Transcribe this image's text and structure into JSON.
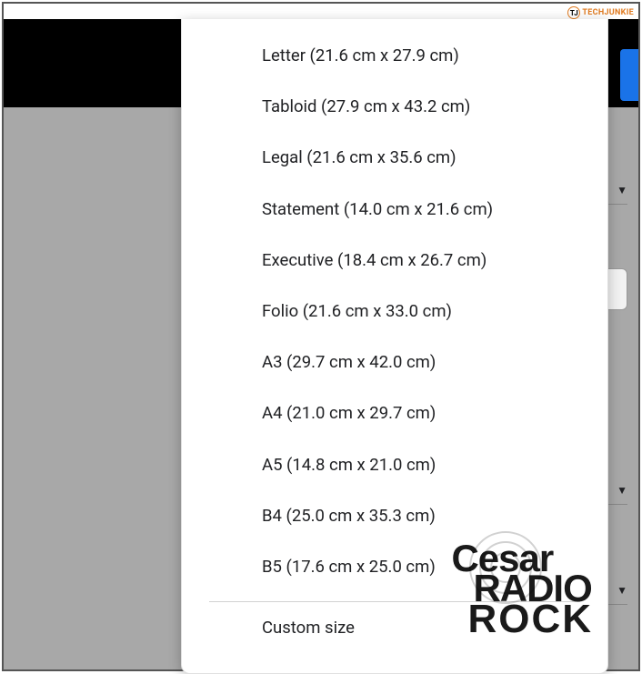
{
  "watermark_top": "TECHJUNKIE",
  "watermark_top_icon": "TJ",
  "paper_sizes": [
    "Letter (21.6 cm x 27.9 cm)",
    "Tabloid (27.9 cm x 43.2 cm)",
    "Legal (21.6 cm x 35.6 cm)",
    "Statement (14.0 cm x 21.6 cm)",
    "Executive (18.4 cm x 26.7 cm)",
    "Folio (21.6 cm x 33.0 cm)",
    "A3 (29.7 cm x 42.0 cm)",
    "A4 (21.0 cm x 29.7 cm)",
    "A5 (14.8 cm x 21.0 cm)",
    "B4 (25.0 cm x 35.3 cm)",
    "B5 (17.6 cm x 25.0 cm)"
  ],
  "custom_size_label": "Custom size",
  "watermark_center": {
    "line1": "Cesar",
    "line2": "RADIO",
    "line3": "ROCK"
  }
}
